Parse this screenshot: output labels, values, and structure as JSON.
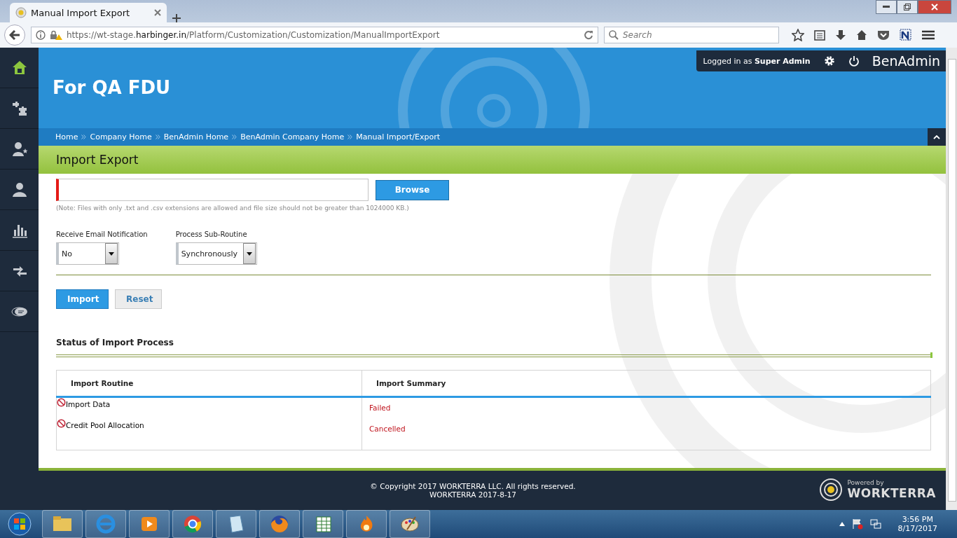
{
  "browser": {
    "tab_title": "Manual Import Export",
    "url_prefix": "https://wt-stage.",
    "url_domain": "harbinger.in",
    "url_path": "/Platform/Customization/Customization/ManualImportExport",
    "search_placeholder": "Search"
  },
  "sidebar": {
    "items": [
      {
        "selected": true
      },
      {
        "selected": false
      },
      {
        "selected": false
      },
      {
        "selected": false
      },
      {
        "selected": false
      },
      {
        "selected": false
      },
      {
        "selected": false
      }
    ]
  },
  "header": {
    "company": "For QA FDU",
    "logged_in_label": "Logged in as",
    "logged_in_role": "Super Admin",
    "brand": "BenAdmin"
  },
  "breadcrumb": [
    "Home",
    "Company Home",
    "BenAdmin Home",
    "BenAdmin Company Home",
    "Manual Import/Export"
  ],
  "page_title": "Import Export",
  "form": {
    "file_field": {
      "required": true
    },
    "browse_button": "Browse",
    "note": "(Note: Files with only .txt and .csv extensions are allowed and file size should not be greater than 1024000 KB.)",
    "selects": [
      {
        "label": "Receive Email Notification",
        "value": "No"
      },
      {
        "label": "Process Sub-Routine",
        "value": "Synchronously"
      }
    ],
    "buttons": [
      {
        "label": "Import",
        "kind": "primary"
      },
      {
        "label": "Reset",
        "kind": "secondary"
      }
    ]
  },
  "status": {
    "title": "Status of Import Process",
    "columns": [
      "Import Routine",
      "Import Summary"
    ],
    "rows": [
      {
        "routine": "Import Data",
        "summary": "Failed"
      },
      {
        "routine": "Credit Pool Allocation",
        "summary": "Cancelled"
      }
    ]
  },
  "footer": {
    "copyright": "© Copyright 2017 WORKTERRA LLC. All rights reserved.",
    "version": "WORKTERRA 2017-8-17",
    "powered_by": "Powered by",
    "powered_brand": "WORKTERRA"
  },
  "taskbar": {
    "time": "3:56 PM",
    "date": "8/17/2017"
  }
}
